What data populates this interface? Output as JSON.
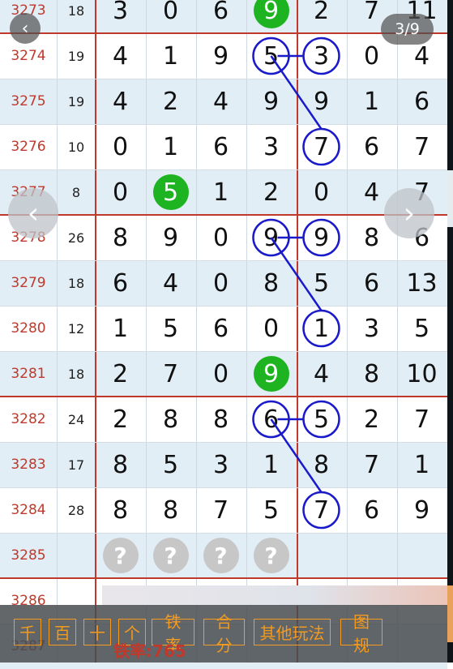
{
  "nav": {
    "back_glyph": "‹",
    "pager": "3/9",
    "prev_glyph": "‹",
    "next_glyph": "›"
  },
  "rows": [
    {
      "issue": "3273",
      "sum": "18",
      "digits": [
        "3",
        "0",
        "6",
        "9",
        "2",
        "7",
        "11"
      ]
    },
    {
      "issue": "3274",
      "sum": "19",
      "digits": [
        "4",
        "1",
        "9",
        "5",
        "3",
        "0",
        "4"
      ]
    },
    {
      "issue": "3275",
      "sum": "19",
      "digits": [
        "4",
        "2",
        "4",
        "9",
        "9",
        "1",
        "6"
      ]
    },
    {
      "issue": "3276",
      "sum": "10",
      "digits": [
        "0",
        "1",
        "6",
        "3",
        "7",
        "6",
        "7"
      ]
    },
    {
      "issue": "3277",
      "sum": "8",
      "digits": [
        "0",
        "5",
        "1",
        "2",
        "0",
        "4",
        "7"
      ]
    },
    {
      "issue": "3278",
      "sum": "26",
      "digits": [
        "8",
        "9",
        "0",
        "9",
        "9",
        "8",
        "6"
      ]
    },
    {
      "issue": "3279",
      "sum": "18",
      "digits": [
        "6",
        "4",
        "0",
        "8",
        "5",
        "6",
        "13"
      ]
    },
    {
      "issue": "3280",
      "sum": "12",
      "digits": [
        "1",
        "5",
        "6",
        "0",
        "1",
        "3",
        "5"
      ]
    },
    {
      "issue": "3281",
      "sum": "18",
      "digits": [
        "2",
        "7",
        "0",
        "9",
        "4",
        "8",
        "10"
      ]
    },
    {
      "issue": "3282",
      "sum": "24",
      "digits": [
        "2",
        "8",
        "8",
        "6",
        "5",
        "2",
        "7"
      ]
    },
    {
      "issue": "3283",
      "sum": "17",
      "digits": [
        "8",
        "5",
        "3",
        "1",
        "8",
        "7",
        "1"
      ]
    },
    {
      "issue": "3284",
      "sum": "28",
      "digits": [
        "8",
        "8",
        "7",
        "5",
        "7",
        "6",
        "9"
      ]
    },
    {
      "issue": "3285",
      "sum": "",
      "digits": []
    },
    {
      "issue": "3286",
      "sum": "",
      "digits": []
    },
    {
      "issue": "3287",
      "sum": "",
      "digits": []
    }
  ],
  "green_marks": [
    {
      "row": 0,
      "col": 3
    },
    {
      "row": 4,
      "col": 1
    },
    {
      "row": 8,
      "col": 3
    }
  ],
  "circle_marks": [
    {
      "row": 1,
      "col": 3
    },
    {
      "row": 1,
      "col": 4
    },
    {
      "row": 3,
      "col": 4
    },
    {
      "row": 5,
      "col": 3
    },
    {
      "row": 5,
      "col": 4
    },
    {
      "row": 7,
      "col": 4
    },
    {
      "row": 9,
      "col": 3
    },
    {
      "row": 9,
      "col": 4
    },
    {
      "row": 11,
      "col": 4
    }
  ],
  "pending": {
    "row": 12,
    "glyph": "?",
    "count": 4
  },
  "toolbar": [
    "千",
    "百",
    "十",
    "个",
    "铁率",
    "合分",
    "其他玩法",
    "图规"
  ],
  "rate_label": "铁率:765",
  "colors": {
    "accent": "#f39a1f",
    "issue": "#c0392b",
    "green": "#1db321",
    "circle": "#1a1acb"
  },
  "icons": {
    "back": "chevron-left-icon",
    "prev": "chevron-left-icon",
    "next": "chevron-right-icon"
  }
}
